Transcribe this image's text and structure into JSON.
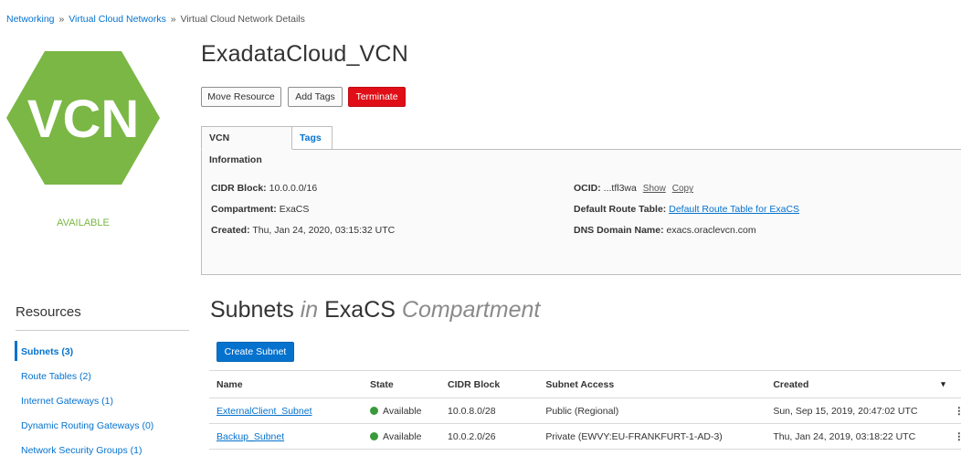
{
  "breadcrumb": {
    "items": [
      "Networking",
      "Virtual Cloud Networks"
    ],
    "current": "Virtual Cloud Network Details",
    "separator": "»"
  },
  "vcn": {
    "icon_text": "VCN",
    "status": "AVAILABLE",
    "title": "ExadataCloud_VCN",
    "colors": {
      "hex_fill": "#7ab744",
      "status": "#7ab744"
    }
  },
  "actions": {
    "move": "Move Resource",
    "add_tags": "Add Tags",
    "terminate": "Terminate"
  },
  "tabs": [
    {
      "label": "VCN Information",
      "active": true
    },
    {
      "label": "Tags",
      "active": false
    }
  ],
  "info": {
    "cidr_label": "CIDR Block:",
    "cidr_value": "10.0.0.0/16",
    "compartment_label": "Compartment:",
    "compartment_value": "ExaCS",
    "created_label": "Created:",
    "created_value": "Thu, Jan 24, 2020, 03:15:32 UTC",
    "ocid_label": "OCID:",
    "ocid_value": "...tfl3wa",
    "ocid_show": "Show",
    "ocid_copy": "Copy",
    "route_label": "Default Route Table:",
    "route_value": "Default Route Table for ExaCS",
    "dns_label": "DNS Domain Name:",
    "dns_value": "exacs.oraclevcn.com"
  },
  "resources": {
    "title": "Resources",
    "items": [
      {
        "label": "Subnets (3)",
        "active": true
      },
      {
        "label": "Route Tables (2)",
        "active": false
      },
      {
        "label": "Internet Gateways (1)",
        "active": false
      },
      {
        "label": "Dynamic Routing Gateways (0)",
        "active": false
      },
      {
        "label": "Network Security Groups (1)",
        "active": false
      }
    ]
  },
  "subnets": {
    "title_main": "Subnets",
    "title_in": "in",
    "title_comp": "ExaCS",
    "title_suffix": "Compartment",
    "create_button": "Create Subnet",
    "columns": [
      "Name",
      "State",
      "CIDR Block",
      "Subnet Access",
      "Created"
    ],
    "sort_icon": "▾",
    "rows": [
      {
        "name": "ExternalClient_Subnet",
        "state": "Available",
        "cidr": "10.0.8.0/28",
        "access": "Public (Regional)",
        "created": "Sun, Sep 15, 2019, 20:47:02 UTC"
      },
      {
        "name": "Backup_Subnet",
        "state": "Available",
        "cidr": "10.0.2.0/26",
        "access": "Private (EWVY:EU-FRANKFURT-1-AD-3)",
        "created": "Thu, Jan 24, 2019, 03:18:22 UTC"
      }
    ]
  }
}
